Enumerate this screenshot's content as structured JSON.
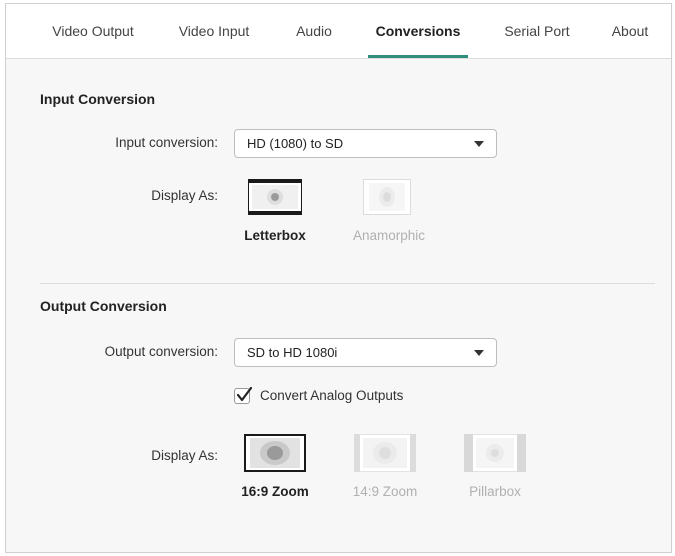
{
  "tabs": [
    {
      "label": "Video Output",
      "active": false
    },
    {
      "label": "Video Input",
      "active": false
    },
    {
      "label": "Audio",
      "active": false
    },
    {
      "label": "Conversions",
      "active": true
    },
    {
      "label": "Serial Port",
      "active": false
    },
    {
      "label": "About",
      "active": false
    }
  ],
  "colors": {
    "accent": "#2e8f7f",
    "selected_label": "#222222",
    "disabled_label": "#b0b0b0"
  },
  "input_conversion": {
    "title": "Input Conversion",
    "select_label": "Input conversion:",
    "select_value": "HD (1080) to SD",
    "display_as_label": "Display As:",
    "options": [
      {
        "label": "Letterbox",
        "icon": "letterbox-icon",
        "selected": true
      },
      {
        "label": "Anamorphic",
        "icon": "anamorphic-icon",
        "selected": false
      }
    ]
  },
  "output_conversion": {
    "title": "Output Conversion",
    "select_label": "Output conversion:",
    "select_value": "SD to HD 1080i",
    "checkbox_label": "Convert Analog Outputs",
    "checkbox_checked": true,
    "display_as_label": "Display As:",
    "options": [
      {
        "label": "16:9 Zoom",
        "icon": "zoom-16-9-icon",
        "selected": true
      },
      {
        "label": "14:9 Zoom",
        "icon": "zoom-14-9-icon",
        "selected": false
      },
      {
        "label": "Pillarbox",
        "icon": "pillarbox-icon",
        "selected": false
      }
    ]
  }
}
